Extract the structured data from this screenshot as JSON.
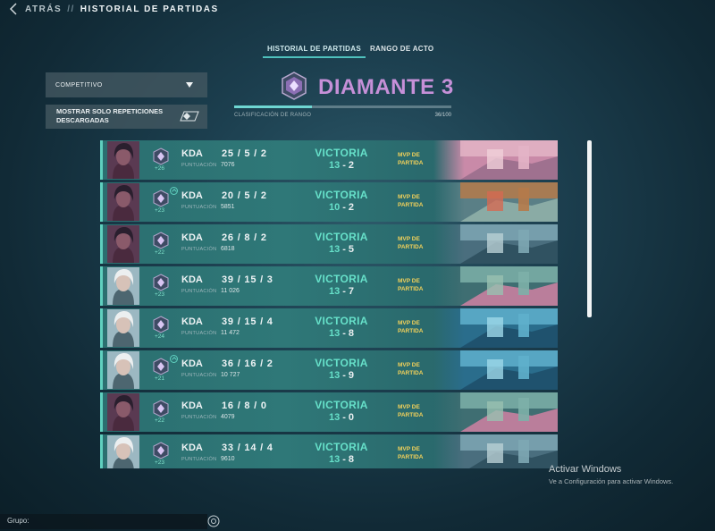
{
  "header": {
    "back_label": "ATRÁS",
    "separator": "//",
    "title": "HISTORIAL DE PARTIDAS"
  },
  "tabs": [
    {
      "label": "HISTORIAL DE PARTIDAS",
      "active": true
    },
    {
      "label": "RANGO DE ACTO",
      "active": false
    }
  ],
  "filters": {
    "queue_selected": "COMPETITIVO",
    "downloaded_toggle": {
      "line1": "MOSTRAR SOLO REPETICIONES",
      "line2": "DESCARGADAS"
    }
  },
  "rank": {
    "name": "DIAMANTE 3",
    "color": "#c690d8",
    "progress_label": "CLASIFICACIÓN DE RANGO",
    "progress_text": "36/100",
    "progress_fraction": 0.36
  },
  "matches": [
    {
      "agent": "dark-haired-agent-portrait",
      "rr": "+26",
      "rank_up": false,
      "kda_label": "KDA",
      "kda": "25 / 5 / 2",
      "score_label": "PUNTUACIÓN",
      "score": "7076",
      "result": "VICTORIA",
      "rounds_won": "13",
      "rounds_lost": "2",
      "mvp": [
        "MVP DE",
        "PARTIDA"
      ],
      "map": "pink-city-map"
    },
    {
      "agent": "dark-haired-agent-portrait",
      "rr": "+23",
      "rank_up": true,
      "kda_label": "KDA",
      "kda": "20 / 5 / 2",
      "score_label": "PUNTUACIÓN",
      "score": "5851",
      "result": "VICTORIA",
      "rounds_won": "10",
      "rounds_lost": "2",
      "mvp": [
        "MVP DE",
        "PARTIDA"
      ],
      "map": "rooftop-map"
    },
    {
      "agent": "dark-haired-agent-portrait",
      "rr": "+22",
      "rank_up": false,
      "kda_label": "KDA",
      "kda": "26 / 8 / 2",
      "score_label": "PUNTUACIÓN",
      "score": "6818",
      "result": "VICTORIA",
      "rounds_won": "13",
      "rounds_lost": "5",
      "mvp": [
        "MVP DE",
        "PARTIDA"
      ],
      "map": "waterway-map"
    },
    {
      "agent": "white-haired-agent-portrait",
      "rr": "+23",
      "rank_up": false,
      "kda_label": "KDA",
      "kda": "39 / 15 / 3",
      "score_label": "PUNTUACIÓN",
      "score": "11 026",
      "result": "VICTORIA",
      "rounds_won": "13",
      "rounds_lost": "7",
      "mvp": [
        "MVP DE",
        "PARTIDA"
      ],
      "map": "jungle-temple-map"
    },
    {
      "agent": "white-haired-agent-portrait",
      "rr": "+24",
      "rank_up": false,
      "kda_label": "KDA",
      "kda": "39 / 15 / 4",
      "score_label": "PUNTUACIÓN",
      "score": "11 472",
      "result": "VICTORIA",
      "rounds_won": "13",
      "rounds_lost": "8",
      "mvp": [
        "MVP DE",
        "PARTIDA"
      ],
      "map": "ocean-map"
    },
    {
      "agent": "white-haired-agent-portrait",
      "rr": "+21",
      "rank_up": true,
      "kda_label": "KDA",
      "kda": "36 / 16 / 2",
      "score_label": "PUNTUACIÓN",
      "score": "10 727",
      "result": "VICTORIA",
      "rounds_won": "13",
      "rounds_lost": "9",
      "mvp": [
        "MVP DE",
        "PARTIDA"
      ],
      "map": "ocean-map"
    },
    {
      "agent": "dark-haired-agent-portrait",
      "rr": "+22",
      "rank_up": false,
      "kda_label": "KDA",
      "kda": "16 / 8 / 0",
      "score_label": "PUNTUACIÓN",
      "score": "4079",
      "result": "VICTORIA",
      "rounds_won": "13",
      "rounds_lost": "0",
      "mvp": [
        "MVP DE",
        "PARTIDA"
      ],
      "map": "jungle-temple-map"
    },
    {
      "agent": "white-haired-agent-portrait",
      "rr": "+23",
      "rank_up": false,
      "kda_label": "KDA",
      "kda": "33 / 14 / 4",
      "score_label": "PUNTUACIÓN",
      "score": "9610",
      "result": "VICTORIA",
      "rounds_won": "13",
      "rounds_lost": "8",
      "mvp": [
        "MVP DE",
        "PARTIDA"
      ],
      "map": "waterway-map"
    }
  ],
  "watermark": {
    "line1": "Activar Windows",
    "line2": "Ve a Configuración para activar Windows."
  },
  "group": {
    "label": "Grupo:"
  },
  "colors": {
    "accent": "#5fd0bf",
    "victory": "#66e0c9",
    "mvp": "#f2d15a"
  }
}
